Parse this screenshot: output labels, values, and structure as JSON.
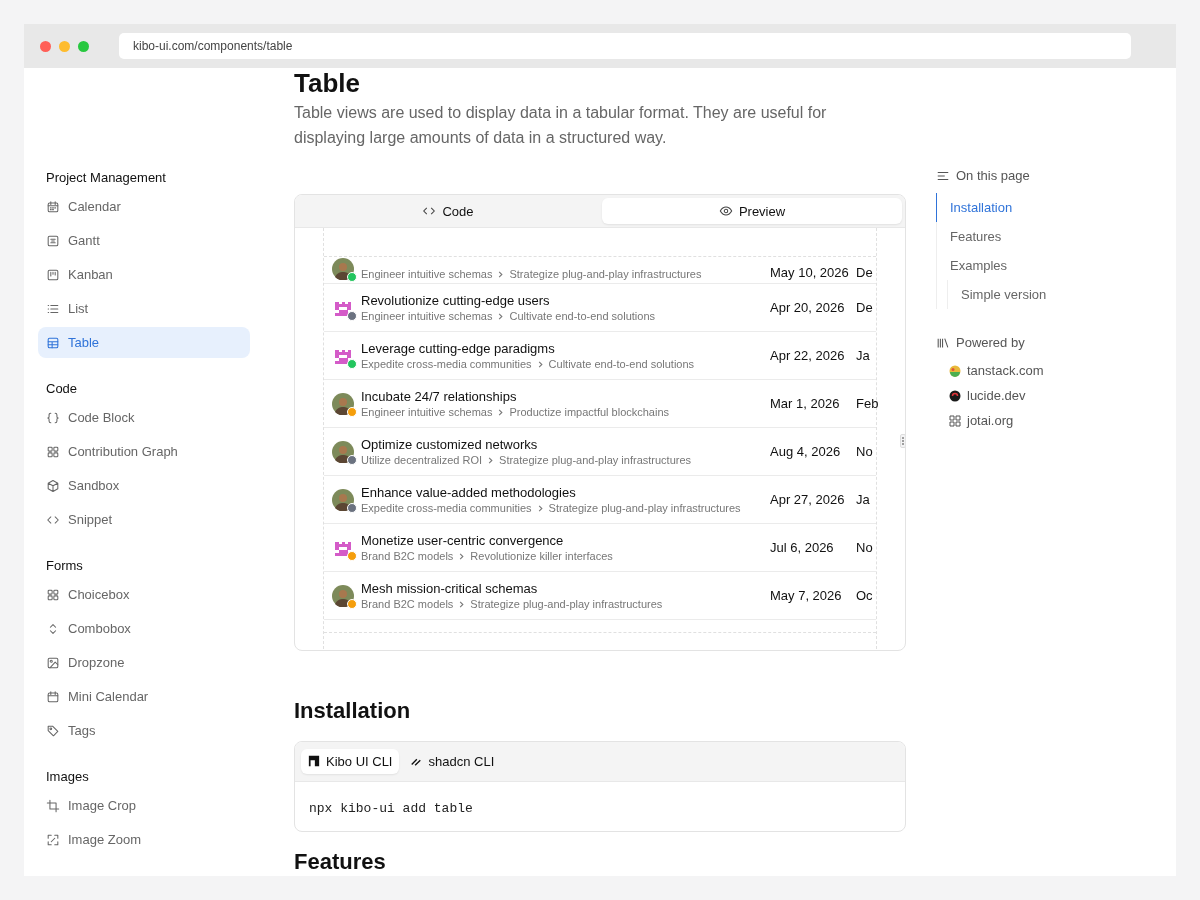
{
  "browser": {
    "url": "kibo-ui.com/components/table"
  },
  "sidebar": {
    "groups": [
      {
        "label": "Project Management",
        "items": [
          {
            "label": "Calendar",
            "selected": false
          },
          {
            "label": "Gantt",
            "selected": false
          },
          {
            "label": "Kanban",
            "selected": false
          },
          {
            "label": "List",
            "selected": false
          },
          {
            "label": "Table",
            "selected": true
          }
        ]
      },
      {
        "label": "Code",
        "items": [
          {
            "label": "Code Block",
            "selected": false
          },
          {
            "label": "Contribution Graph",
            "selected": false
          },
          {
            "label": "Sandbox",
            "selected": false
          },
          {
            "label": "Snippet",
            "selected": false
          }
        ]
      },
      {
        "label": "Forms",
        "items": [
          {
            "label": "Choicebox",
            "selected": false
          },
          {
            "label": "Combobox",
            "selected": false
          },
          {
            "label": "Dropzone",
            "selected": false
          },
          {
            "label": "Mini Calendar",
            "selected": false
          },
          {
            "label": "Tags",
            "selected": false
          }
        ]
      },
      {
        "label": "Images",
        "items": [
          {
            "label": "Image Crop",
            "selected": false
          },
          {
            "label": "Image Zoom",
            "selected": false
          }
        ]
      }
    ]
  },
  "page": {
    "title": "Table",
    "description": "Table views are used to display data in a tabular format. They are useful for displaying large amounts of data in a structured way.",
    "preview": {
      "tabs": [
        {
          "label": "Code",
          "selected": false
        },
        {
          "label": "Preview",
          "selected": true
        }
      ],
      "rows": [
        {
          "kind": "photo",
          "color": "#22c55e",
          "from": "Engineer intuitive schemas",
          "to": "Strategize plug-and-play infrastructures",
          "start": "May 10, 2026",
          "end": "De"
        },
        {
          "kind": "logo",
          "color": "#6b7280",
          "title": "Revolutionize cutting-edge users",
          "from": "Engineer intuitive schemas",
          "to": "Cultivate end-to-end solutions",
          "start": "Apr 20, 2026",
          "end": "De"
        },
        {
          "kind": "logo",
          "color": "#22c55e",
          "title": "Leverage cutting-edge paradigms",
          "from": "Expedite cross-media communities",
          "to": "Cultivate end-to-end solutions",
          "start": "Apr 22, 2026",
          "end": "Ja"
        },
        {
          "kind": "photo",
          "color": "#f59e0b",
          "title": "Incubate 24/7 relationships",
          "from": "Engineer intuitive schemas",
          "to": "Productize impactful blockchains",
          "start": "Mar 1, 2026",
          "end": "Feb"
        },
        {
          "kind": "photo",
          "color": "#6b7280",
          "title": "Optimize customized networks",
          "from": "Utilize decentralized ROI",
          "to": "Strategize plug-and-play infrastructures",
          "start": "Aug 4, 2026",
          "end": "No"
        },
        {
          "kind": "photo",
          "color": "#6b7280",
          "title": "Enhance value-added methodologies",
          "from": "Expedite cross-media communities",
          "to": "Strategize plug-and-play infrastructures",
          "start": "Apr 27, 2026",
          "end": "Ja"
        },
        {
          "kind": "logo",
          "color": "#f59e0b",
          "title": "Monetize user-centric convergence",
          "from": "Brand B2C models",
          "to": "Revolutionize killer interfaces",
          "start": "Jul 6, 2026",
          "end": "No"
        },
        {
          "kind": "photo",
          "color": "#f59e0b",
          "title": "Mesh mission-critical schemas",
          "from": "Brand B2C models",
          "to": "Strategize plug-and-play infrastructures",
          "start": "May 7, 2026",
          "end": "Oc"
        }
      ]
    },
    "installation": {
      "title": "Installation",
      "tabs": [
        {
          "label": "Kibo UI CLI",
          "selected": true
        },
        {
          "label": "shadcn CLI",
          "selected": false
        }
      ],
      "command": "npx kibo-ui add table"
    },
    "next_heading": "Features"
  },
  "toc": {
    "title": "On this page",
    "items": [
      {
        "label": "Installation",
        "selected": true
      },
      {
        "label": "Features",
        "selected": false
      },
      {
        "label": "Examples",
        "selected": false,
        "children": [
          {
            "label": "Simple version",
            "selected": false
          }
        ]
      }
    ]
  },
  "powered_by": {
    "title": "Powered by",
    "links": [
      "tanstack.com",
      "lucide.dev",
      "jotai.org"
    ]
  }
}
